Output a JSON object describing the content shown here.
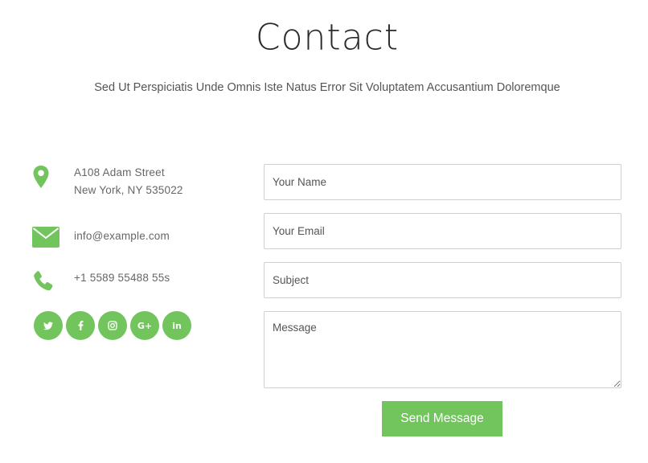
{
  "header": {
    "title": "Contact",
    "subtitle": "Sed Ut Perspiciatis Unde Omnis Iste Natus Error Sit Voluptatem Accusantium Doloremque"
  },
  "contact_info": {
    "address_line1": "A108 Adam Street",
    "address_line2": "New York, NY 535022",
    "email": "info@example.com",
    "phone": "+1 5589 55488 55s"
  },
  "socials": [
    {
      "icon": "twitter-icon",
      "glyph": "🐦"
    },
    {
      "icon": "facebook-icon",
      "glyph": "f"
    },
    {
      "icon": "instagram-icon",
      "glyph": "◎"
    },
    {
      "icon": "google-plus-icon",
      "glyph": "G+"
    },
    {
      "icon": "linkedin-icon",
      "glyph": "in"
    }
  ],
  "form": {
    "name_placeholder": "Your Name",
    "email_placeholder": "Your Email",
    "subject_placeholder": "Subject",
    "message_placeholder": "Message",
    "submit_label": "Send Message"
  },
  "colors": {
    "accent": "#72c55c"
  }
}
